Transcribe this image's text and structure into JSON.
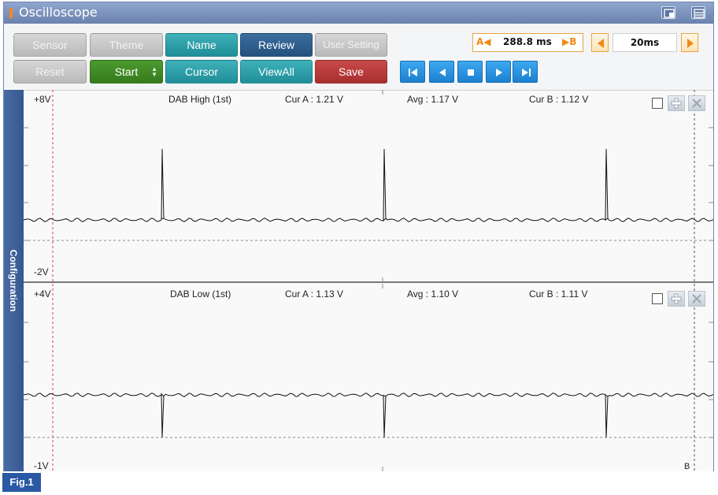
{
  "window": {
    "title": "Oscilloscope"
  },
  "toolbar": {
    "sensor": "Sensor",
    "theme": "Theme",
    "name": "Name",
    "review": "Review",
    "user_setting": "User Setting",
    "reset": "Reset",
    "start": "Start",
    "cursor": "Cursor",
    "view_all": "ViewAll",
    "save": "Save",
    "cursor_a_label": "A",
    "cursor_b_label": "B",
    "cursor_span": "288.8 ms",
    "time_div": "20ms"
  },
  "sidebar": {
    "config_label": "Configuration"
  },
  "colors": {
    "accent_orange": "#ef8a16",
    "trace": "#111111",
    "cursor_a": "#e23b3b",
    "grid": "#9a9a9a"
  },
  "panes": [
    {
      "channel": "DAB High (1st)",
      "y_max_label": "+8V",
      "y_min_label": "-2V",
      "cur_a": "Cur A : 1.21 V",
      "avg": "Avg : 1.17 V",
      "cur_b": "Cur B : 1.12 V"
    },
    {
      "channel": "DAB Low (1st)",
      "y_max_label": "+4V",
      "y_min_label": "-1V",
      "cur_a": "Cur A : 1.13 V",
      "avg": "Avg : 1.10 V",
      "cur_b": "Cur B : 1.11 V",
      "cursor_b_marker": "B"
    }
  ],
  "figure_label": "Fig.1"
}
